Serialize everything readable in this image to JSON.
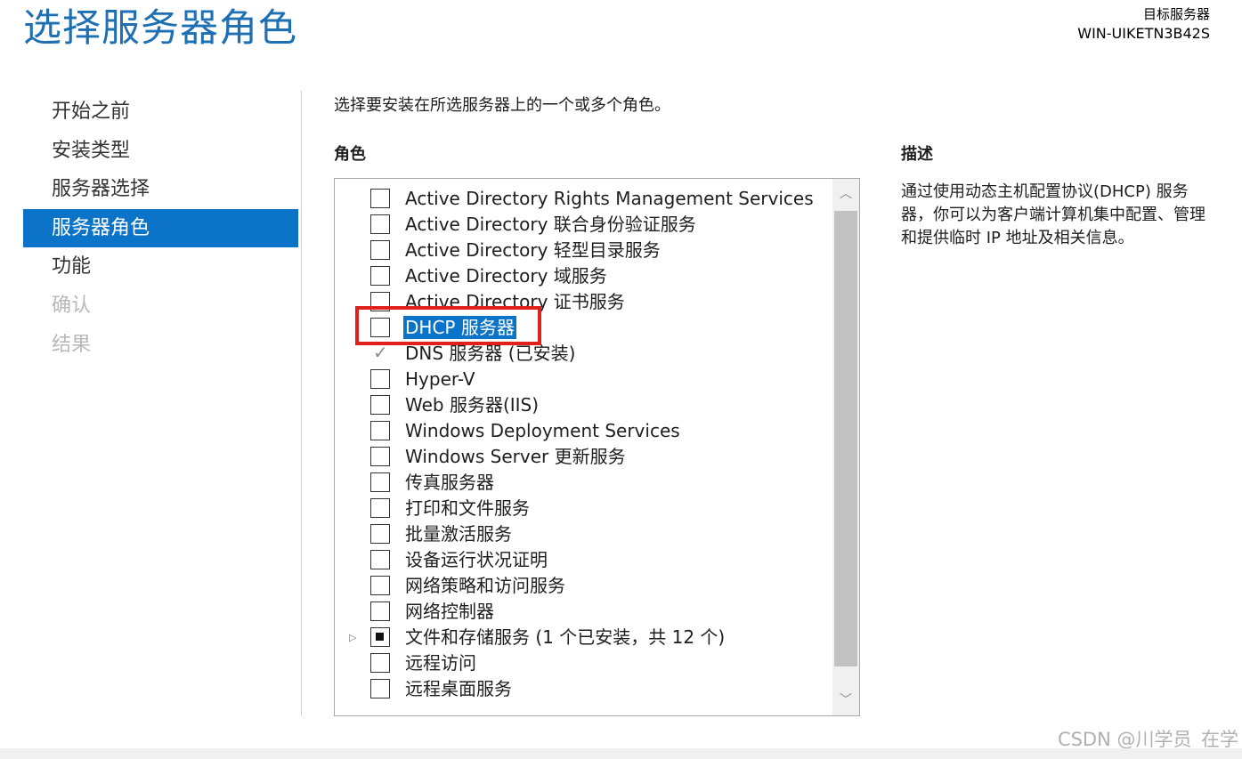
{
  "header": {
    "title": "选择服务器角色",
    "target_label": "目标服务器",
    "target_server": "WIN-UIKETN3B42S"
  },
  "nav": {
    "items": [
      {
        "label": "开始之前",
        "state": "normal"
      },
      {
        "label": "安装类型",
        "state": "normal"
      },
      {
        "label": "服务器选择",
        "state": "normal"
      },
      {
        "label": "服务器角色",
        "state": "active"
      },
      {
        "label": "功能",
        "state": "normal"
      },
      {
        "label": "确认",
        "state": "disabled"
      },
      {
        "label": "结果",
        "state": "disabled"
      }
    ]
  },
  "main": {
    "instruction": "选择要安装在所选服务器上的一个或多个角色。",
    "roles_heading": "角色",
    "roles": [
      {
        "label": "Active Directory Rights Management Services",
        "checked": "unchecked"
      },
      {
        "label": "Active Directory 联合身份验证服务",
        "checked": "unchecked"
      },
      {
        "label": "Active Directory 轻型目录服务",
        "checked": "unchecked"
      },
      {
        "label": "Active Directory 域服务",
        "checked": "unchecked"
      },
      {
        "label": "Active Directory 证书服务",
        "checked": "unchecked"
      },
      {
        "label": "DHCP 服务器",
        "checked": "unchecked",
        "selected": true
      },
      {
        "label": "DNS 服务器 (已安装)",
        "checked": "checked-disabled"
      },
      {
        "label": "Hyper-V",
        "checked": "unchecked"
      },
      {
        "label": "Web 服务器(IIS)",
        "checked": "unchecked"
      },
      {
        "label": "Windows Deployment Services",
        "checked": "unchecked"
      },
      {
        "label": "Windows Server 更新服务",
        "checked": "unchecked"
      },
      {
        "label": "传真服务器",
        "checked": "unchecked"
      },
      {
        "label": "打印和文件服务",
        "checked": "unchecked"
      },
      {
        "label": "批量激活服务",
        "checked": "unchecked"
      },
      {
        "label": "设备运行状况证明",
        "checked": "unchecked"
      },
      {
        "label": "网络策略和访问服务",
        "checked": "unchecked"
      },
      {
        "label": "网络控制器",
        "checked": "unchecked"
      },
      {
        "label": "文件和存储服务 (1 个已安装，共 12 个)",
        "checked": "partial",
        "expandable": true
      },
      {
        "label": "远程访问",
        "checked": "unchecked"
      },
      {
        "label": "远程桌面服务",
        "checked": "unchecked"
      }
    ],
    "expander_icon": "▷",
    "scroll_up_icon": "︿",
    "scroll_down_icon": "﹀"
  },
  "description": {
    "heading": "描述",
    "text": "通过使用动态主机配置协议(DHCP) 服务器，你可以为客户端计算机集中配置、管理和提供临时 IP 地址及相关信息。"
  },
  "watermark": "CSDN @川学员_在学",
  "colors": {
    "title": "#1f6fb3",
    "nav_active_bg": "#0b74c8",
    "selection_bg": "#0b74c8",
    "annotation_border": "#e0201b"
  }
}
